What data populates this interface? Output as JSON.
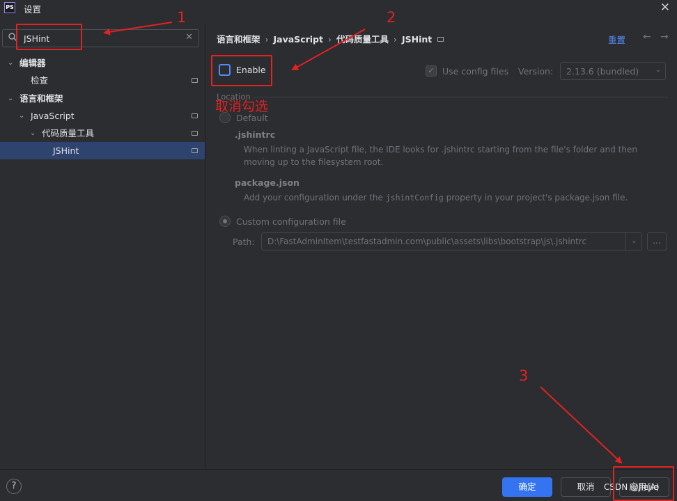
{
  "window": {
    "app_icon": "PS",
    "title": "设置",
    "close_symbol": "✕"
  },
  "sidebar": {
    "search": {
      "value": "JSHint",
      "placeholder": ""
    },
    "tree": [
      {
        "label": "编辑器",
        "expanded": true
      },
      {
        "label": "检查"
      },
      {
        "label": "语言和框架",
        "expanded": true
      },
      {
        "label": "JavaScript",
        "expanded": true
      },
      {
        "label": "代码质量工具",
        "expanded": true
      },
      {
        "label": "JSHint",
        "selected": true
      }
    ],
    "help_label": "?"
  },
  "breadcrumb": {
    "items": [
      "语言和框架",
      "JavaScript",
      "代码质量工具",
      "JSHint"
    ],
    "separator": "›"
  },
  "header": {
    "reset_label": "重置",
    "back_symbol": "←",
    "forward_symbol": "→"
  },
  "settings": {
    "enable": {
      "label": "Enable",
      "checked": false
    },
    "use_config_files": {
      "label": "Use config files",
      "checked": true
    },
    "version": {
      "label": "Version:",
      "value": "2.13.6 (bundled)"
    },
    "location_label": "Location",
    "default_option": {
      "label": "Default",
      "jshintrc_title": ".jshintrc",
      "jshintrc_desc": "When linting a JavaScript file, the IDE looks for .jshintrc starting from the file's folder and then moving up to the filesystem root.",
      "package_title": "package.json",
      "package_desc_before": "Add your configuration under the ",
      "package_desc_code": "jshintConfig",
      "package_desc_after": " property in your project's package.json file."
    },
    "custom_option": {
      "label": "Custom configuration file",
      "selected": true,
      "path_label": "Path:",
      "path_value": "D:\\FastAdminItem\\testfastadmin.com\\public\\assets\\libs\\bootstrap\\js\\.jshintrc",
      "browse_label": "..."
    }
  },
  "footer": {
    "ok_label": "确定",
    "cancel_label": "取消",
    "apply_label": "应用(A)",
    "watermark": "CSDN @Jiejie"
  },
  "annotations": {
    "num1": "1",
    "num2": "2",
    "num3": "3",
    "note": "取消勾选",
    "color": "#e32222"
  },
  "colors": {
    "background": "#2b2d30",
    "accent": "#3574f0",
    "selection": "#2e436e",
    "link": "#548af7"
  }
}
